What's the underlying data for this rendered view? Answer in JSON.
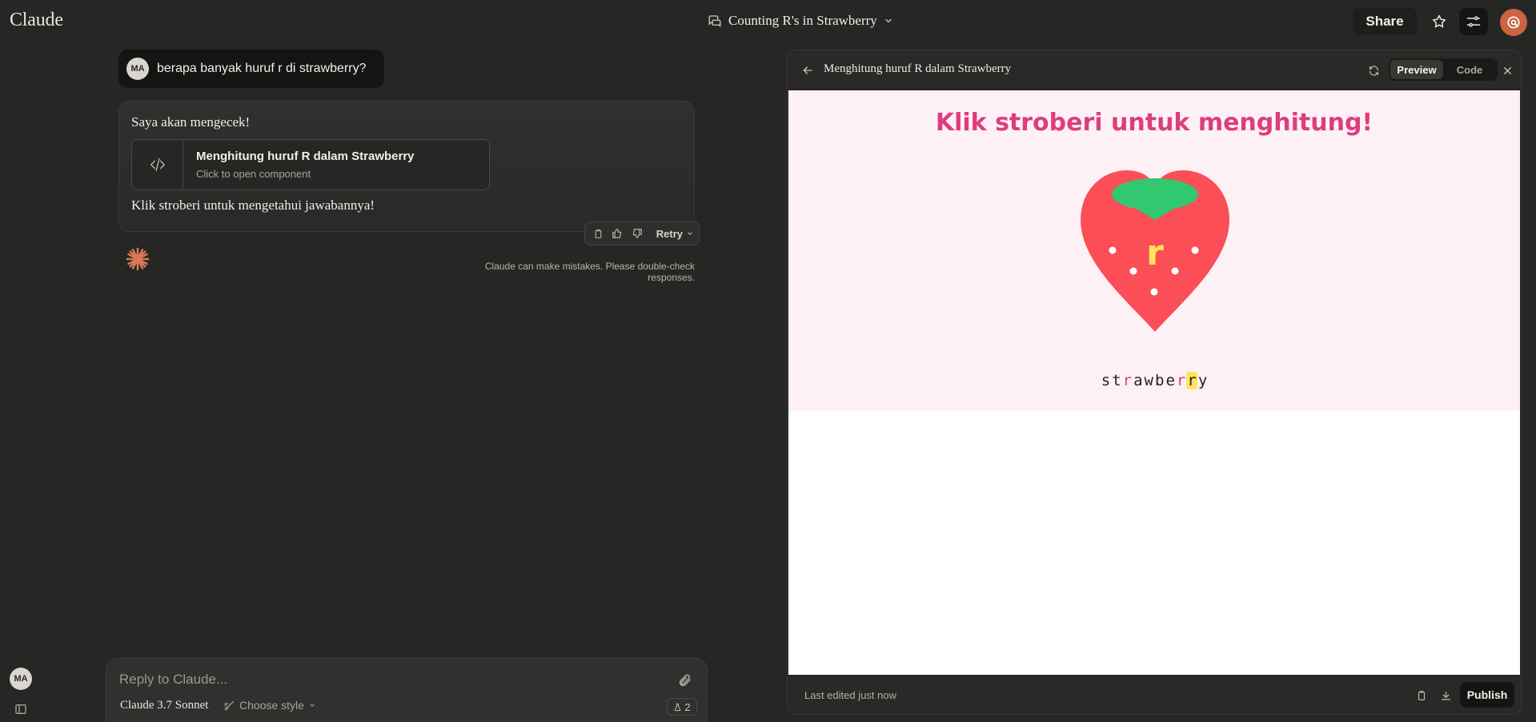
{
  "app": {
    "name": "Claude"
  },
  "header": {
    "conversation_title": "Counting R's in Strawberry",
    "share_label": "Share"
  },
  "chat": {
    "user_initials": "MA",
    "user_message": "berapa banyak huruf r di strawberry?",
    "assistant_intro": "Saya akan mengecek!",
    "artifact_card": {
      "title": "Menghitung huruf R dalam Strawberry",
      "subtitle": "Click to open component"
    },
    "assistant_outro": "Klik stroberi untuk mengetahui jawabannya!",
    "retry_label": "Retry",
    "disclaimer": "Claude can make mistakes. Please double-check responses."
  },
  "composer": {
    "placeholder": "Reply to Claude...",
    "model": "Claude 3.7 Sonnet",
    "style_label": "Choose style",
    "count": "2"
  },
  "panel": {
    "title": "Menghitung huruf R dalam Strawberry",
    "tab_preview": "Preview",
    "tab_code": "Code",
    "active_tab": "Preview",
    "last_edited": "Last edited just now",
    "publish_label": "Publish"
  },
  "artifact": {
    "heading": "Klik stroberi untuk menghitung!",
    "current_letter": "r",
    "word_letters": [
      "s",
      "t",
      "r",
      "a",
      "w",
      "b",
      "e",
      "r",
      "r",
      "y"
    ],
    "highlighted_index": 8
  },
  "colors": {
    "accent": "#c96442",
    "heading_pink": "#dd3d7e",
    "strawberry_red": "#fb4e57",
    "leaf_green": "#32c86f",
    "letter_yellow": "#ffe55c",
    "preview_bg": "#fdf1f6"
  },
  "icons": {
    "title": "chat-bubble-icon",
    "star": "star-icon",
    "settings": "sliders-icon",
    "profile": "search-circle-icon",
    "code": "code-icon",
    "spark": "claude-spark-icon"
  }
}
